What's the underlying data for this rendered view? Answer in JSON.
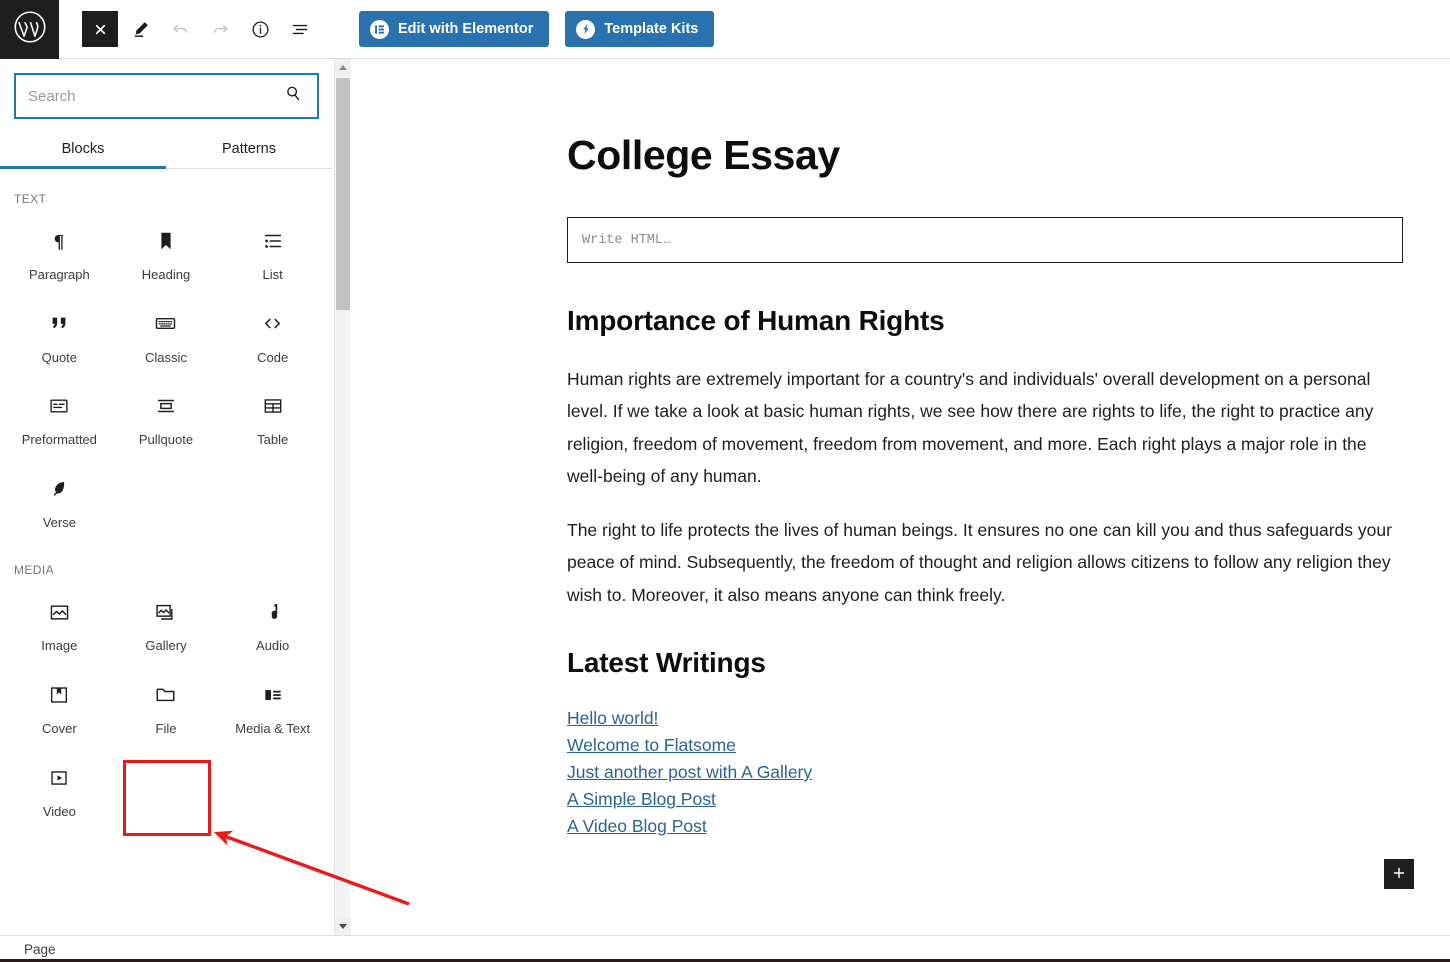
{
  "app": {
    "logo_icon": "wordpress-logo"
  },
  "toolbar": {
    "tools": [
      {
        "name": "close-editor-button",
        "icon": "close-x-icon",
        "state": "active"
      },
      {
        "name": "edit-mode-button",
        "icon": "pencil-icon",
        "state": "normal"
      },
      {
        "name": "undo-button",
        "icon": "undo-arrow-icon",
        "state": "disabled"
      },
      {
        "name": "redo-button",
        "icon": "redo-arrow-icon",
        "state": "disabled"
      },
      {
        "name": "details-button",
        "icon": "info-circle-icon",
        "state": "normal"
      },
      {
        "name": "list-view-button",
        "icon": "list-view-icon",
        "state": "normal"
      }
    ],
    "elementor_button": "Edit with Elementor",
    "elementor_icon": "elementor-badge-icon",
    "template_kits_button": "Template Kits",
    "template_kits_icon": "template-kits-badge-icon",
    "accent_blue": "#2a72ad"
  },
  "inserter": {
    "search": {
      "value": "",
      "placeholder": "Search",
      "icon": "search-icon",
      "focus_color": "#1b7aa8"
    },
    "tabs": [
      {
        "label": "Blocks",
        "active": true
      },
      {
        "label": "Patterns",
        "active": false
      }
    ],
    "sections": [
      {
        "label": "TEXT",
        "blocks": [
          {
            "label": "Paragraph",
            "icon": "paragraph-icon"
          },
          {
            "label": "Heading",
            "icon": "heading-bookmark-icon"
          },
          {
            "label": "List",
            "icon": "list-icon"
          },
          {
            "label": "Quote",
            "icon": "quote-icon"
          },
          {
            "label": "Classic",
            "icon": "classic-keyboard-icon"
          },
          {
            "label": "Code",
            "icon": "code-brackets-icon"
          },
          {
            "label": "Preformatted",
            "icon": "preformatted-icon"
          },
          {
            "label": "Pullquote",
            "icon": "pullquote-icon"
          },
          {
            "label": "Table",
            "icon": "table-icon"
          },
          {
            "label": "Verse",
            "icon": "verse-feather-icon"
          }
        ]
      },
      {
        "label": "MEDIA",
        "blocks": [
          {
            "label": "Image",
            "icon": "image-icon"
          },
          {
            "label": "Gallery",
            "icon": "gallery-icon"
          },
          {
            "label": "Audio",
            "icon": "audio-note-icon"
          },
          {
            "label": "Cover",
            "icon": "cover-icon",
            "highlighted": false
          },
          {
            "label": "File",
            "icon": "file-folder-icon",
            "highlighted": true
          },
          {
            "label": "Media & Text",
            "icon": "media-and-text-icon"
          },
          {
            "label": "Video",
            "icon": "video-play-icon"
          }
        ]
      }
    ]
  },
  "editor": {
    "post_title": "College Essay",
    "html_block_placeholder": "Write HTML…",
    "heading_1": "Importance of Human Rights",
    "paragraph_1": "Human rights are extremely important for a country's and individuals' overall development on a personal level. If we take a look at basic human rights, we see how there are rights to life, the right to practice any religion, freedom of movement, freedom from movement, and more. Each right plays a major role in the well-being of any human.",
    "paragraph_2": "The right to life protects the lives of human beings. It ensures no one can kill you and thus safeguards your peace of mind. Subsequently, the freedom of thought and religion allows citizens to follow any religion they wish to. Moreover, it also means anyone can think freely.",
    "heading_2": "Latest Writings",
    "links": [
      "Hello world!",
      "Welcome to Flatsome",
      "Just another post with A Gallery",
      "A Simple Blog Post",
      "A Video Blog Post"
    ],
    "add_block_icon": "plus-icon",
    "link_color": "#2a6496"
  },
  "statusbar": {
    "breadcrumb": "Page"
  },
  "annotation": {
    "highlight_color": "#e81b1b",
    "target_block": "File"
  }
}
